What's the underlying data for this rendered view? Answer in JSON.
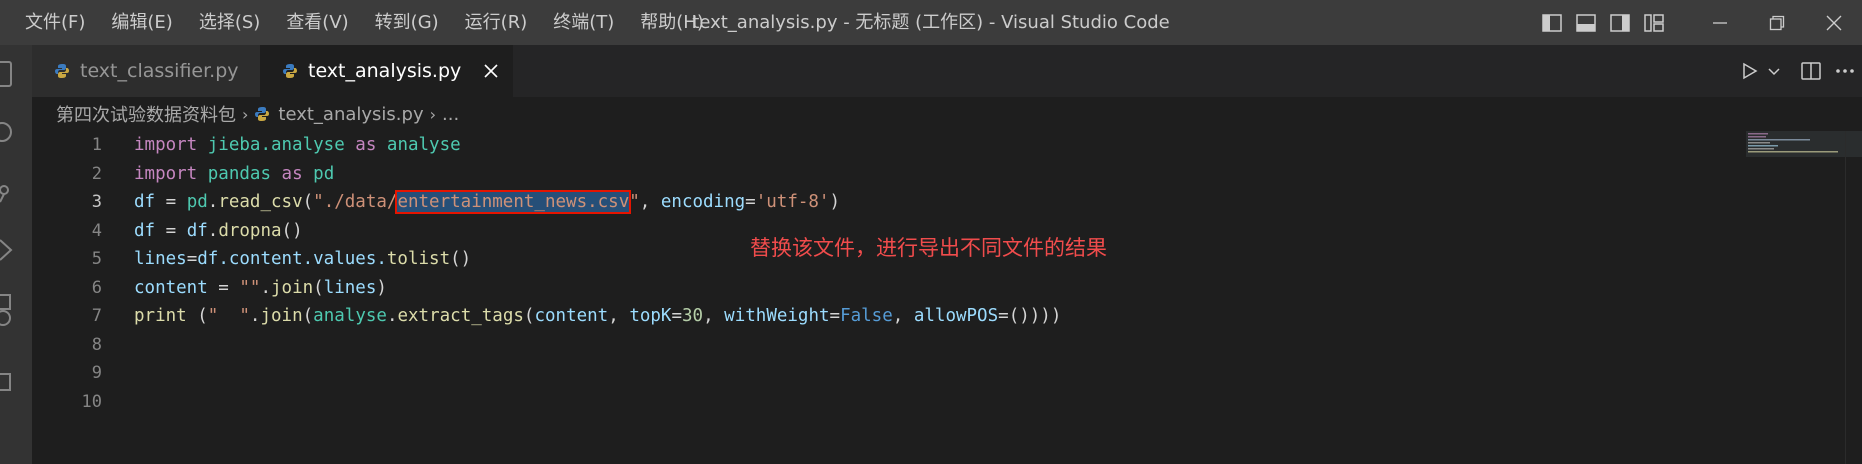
{
  "menu": [
    "文件(F)",
    "编辑(E)",
    "选择(S)",
    "查看(V)",
    "转到(G)",
    "运行(R)",
    "终端(T)",
    "帮助(H)"
  ],
  "window_title": "text_analysis.py - 无标题 (工作区) - Visual Studio Code",
  "tabs": [
    {
      "label": "text_classifier.py",
      "active": false
    },
    {
      "label": "text_analysis.py",
      "active": true
    }
  ],
  "breadcrumb": {
    "folder": "第四次试验数据资料包",
    "file": "text_analysis.py",
    "more": "..."
  },
  "line_numbers": [
    "1",
    "2",
    "3",
    "4",
    "5",
    "6",
    "7",
    "8",
    "9",
    "10"
  ],
  "code": {
    "l1": {
      "kw_import": "import",
      "module": "jieba.analyse",
      "kw_as": "as",
      "alias": "analyse"
    },
    "l2": {
      "kw_import": "import",
      "module": "pandas",
      "kw_as": "as",
      "alias": "pd"
    },
    "l3": {
      "var": "df",
      "op": " = ",
      "obj": "pd",
      "dot": ".",
      "fn": "read_csv",
      "open": "(",
      "str_a": "\"./data/",
      "str_sel": "entertainment_news.csv",
      "str_b": "\"",
      "comma": ", ",
      "param": "encoding",
      "eq": "=",
      "enc": "'utf-8'",
      "close": ")"
    },
    "l4": {
      "var": "df",
      "op": " = ",
      "obj": "df",
      "dot": ".",
      "fn": "dropna",
      "paren": "()"
    },
    "l5": {
      "var": "lines",
      "eq": "=",
      "obj": "df",
      "chain": ".content.values.",
      "fn": "tolist",
      "paren": "()"
    },
    "l6": {
      "var": "content",
      "op": " = ",
      "str": "\"\"",
      "dot": ".",
      "fn": "join",
      "open": "(",
      "arg": "lines",
      "close": ")"
    },
    "l7": {
      "fn_print": "print",
      "sp": " (",
      "str": "\"  \"",
      "dot": ".",
      "fn_join": "join",
      "open1": "(",
      "obj": "analyse",
      "dot2": ".",
      "fn_ext": "extract_tags",
      "open2": "(",
      "arg": "content",
      "c1": ", ",
      "p1": "topK",
      "eq1": "=",
      "n1": "30",
      "c2": ", ",
      "p2": "withWeight",
      "eq2": "=",
      "b1": "False",
      "c3": ", ",
      "p3": "allowPOS",
      "eq3": "=",
      "tail": "())))"
    }
  },
  "annotation": "替换该文件，进行导出不同文件的结果",
  "colors": {
    "keyword": "#c586c0",
    "module": "#4ec9b0",
    "variable": "#9cdcfe",
    "function": "#dcdcaa",
    "string": "#ce9178",
    "number": "#b5cea8",
    "constant": "#569cd6",
    "annotation": "#f14c4c",
    "highlight_box": "#e51400"
  }
}
